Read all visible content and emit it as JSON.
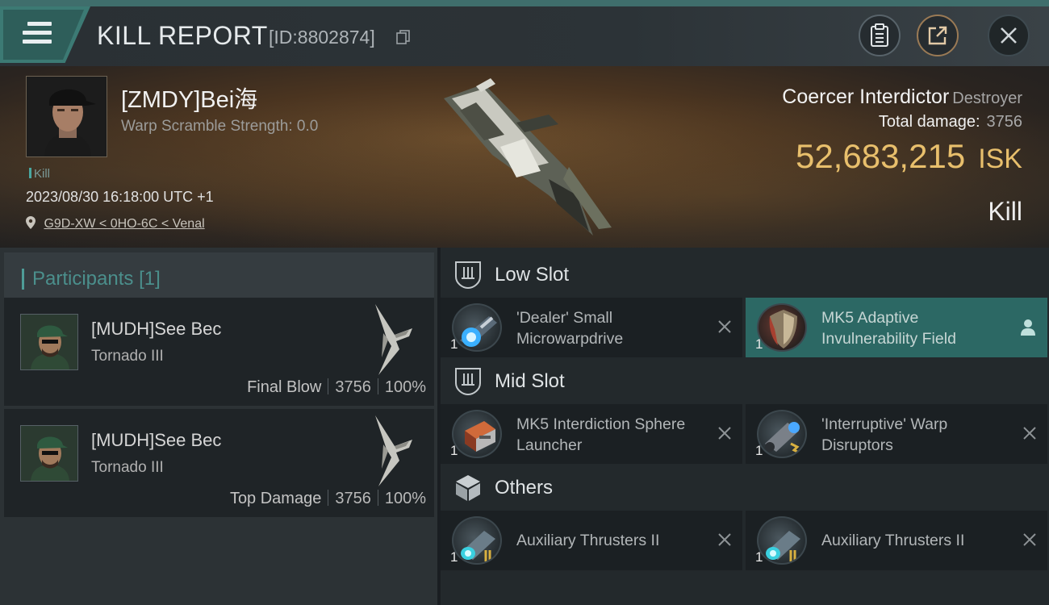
{
  "header": {
    "title": "KILL REPORT",
    "report_id": "[ID:8802874]"
  },
  "victim": {
    "name": "[ZMDY]Bei海",
    "warp_scramble": "Warp Scramble Strength: 0.0",
    "kill_label": "Kill",
    "datetime": "2023/08/30 16:18:00 UTC +1",
    "location": "G9D-XW < 0HO-6C < Venal",
    "ship_name": "Coercer Interdictor",
    "ship_class": "Destroyer",
    "total_damage_label": "Total damage:",
    "total_damage": "3756",
    "isk_value": "52,683,215",
    "isk_unit": "ISK",
    "result": "Kill"
  },
  "participants": {
    "title": "Participants",
    "count": "[1]",
    "list": [
      {
        "name": "[MUDH]See Bec",
        "ship": "Tornado III",
        "label": "Final Blow",
        "damage": "3756",
        "percent": "100%"
      },
      {
        "name": "[MUDH]See Bec",
        "ship": "Tornado III",
        "label": "Top Damage",
        "damage": "3756",
        "percent": "100%"
      }
    ]
  },
  "slots": {
    "low": {
      "title": "Low Slot",
      "modules": [
        {
          "name": "'Dealer' Small Microwarpdrive",
          "qty": "1",
          "icon": "microwarpdrive-icon"
        },
        {
          "name": "MK5 Adaptive Invulnerability Field",
          "qty": "1",
          "icon": "shield-module-icon"
        }
      ]
    },
    "mid": {
      "title": "Mid Slot",
      "modules": [
        {
          "name": "MK5 Interdiction Sphere Launcher",
          "qty": "1",
          "icon": "launcher-icon"
        },
        {
          "name": "'Interruptive' Warp Disruptors",
          "qty": "1",
          "icon": "warp-disruptor-icon"
        }
      ]
    },
    "others": {
      "title": "Others",
      "modules": [
        {
          "name": "Auxiliary Thrusters II",
          "qty": "1",
          "icon": "thruster-icon"
        },
        {
          "name": "Auxiliary Thrusters II",
          "qty": "1",
          "icon": "thruster-icon"
        }
      ]
    }
  },
  "colors": {
    "accent_teal": "#3c7a74",
    "isk_gold": "#e8bf6c",
    "active_module": "#2c6864"
  }
}
